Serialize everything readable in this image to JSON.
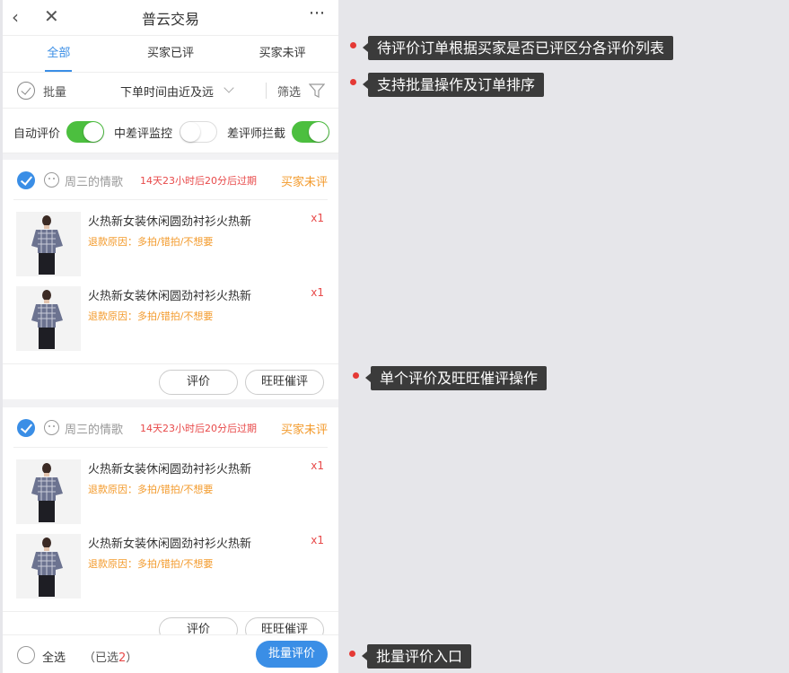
{
  "app": {
    "title": "普云交易"
  },
  "navbar": {
    "back_icon": "back-chevron-icon",
    "close_icon": "close-icon",
    "more_icon": "more-dots-icon"
  },
  "tabs": [
    {
      "label": "全部",
      "active": true
    },
    {
      "label": "买家已评",
      "active": false
    },
    {
      "label": "买家未评",
      "active": false
    }
  ],
  "toolbar": {
    "batch_label": "批量",
    "sort_label": "下单时间由近及远",
    "filter_label": "筛选"
  },
  "switches": [
    {
      "label": "自动评价",
      "on": true
    },
    {
      "label": "中差评监控",
      "on": false
    },
    {
      "label": "差评师拦截",
      "on": true
    }
  ],
  "orders": [
    {
      "buyer": "周三的情歌",
      "expire": "14天23小时后20分后过期",
      "status": "买家未评",
      "items": [
        {
          "title": "火热新女装休闲圆劲衬衫火热新",
          "reason": "退款原因：多拍/错拍/不想要",
          "qty": "x1"
        },
        {
          "title": "火热新女装休闲圆劲衬衫火热新",
          "reason": "退款原因：多拍/错拍/不想要",
          "qty": "x1"
        }
      ],
      "actions": {
        "review": "评价",
        "urge": "旺旺催评"
      }
    },
    {
      "buyer": "周三的情歌",
      "expire": "14天23小时后20分后过期",
      "status": "买家未评",
      "items": [
        {
          "title": "火热新女装休闲圆劲衬衫火热新",
          "reason": "退款原因：多拍/错拍/不想要",
          "qty": "x1"
        },
        {
          "title": "火热新女装休闲圆劲衬衫火热新",
          "reason": "退款原因：多拍/错拍/不想要",
          "qty": "x1"
        }
      ],
      "actions": {
        "review": "评价",
        "urge": "旺旺催评"
      }
    }
  ],
  "bottom": {
    "select_all": "全选",
    "selected_prefix": "（已选",
    "selected_count": "2",
    "selected_suffix": "）",
    "batch_button": "批量评价"
  },
  "annotations": [
    "待评价订单根据买家是否已评区分各评价列表",
    "支持批量操作及订单排序",
    "单个评价及旺旺催评操作",
    "批量评价入口"
  ],
  "colors": {
    "accent": "#3a8ee6",
    "toggle_on": "#4cbf3f",
    "warning": "#f39a2b",
    "danger": "#e84a4a",
    "note_bg": "#3b3b3b"
  }
}
